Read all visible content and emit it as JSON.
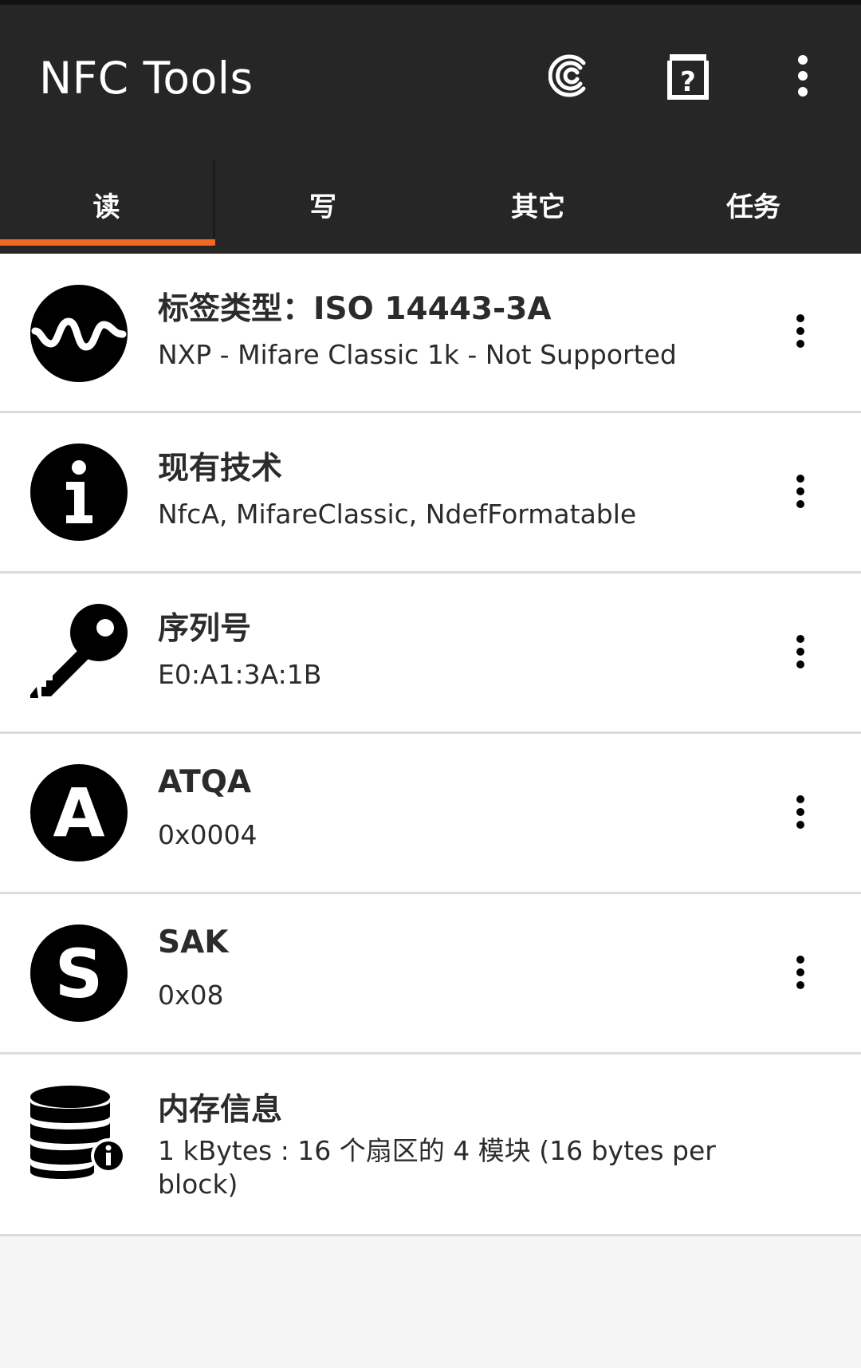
{
  "app": {
    "title": "NFC Tools",
    "accent_color": "#f26722",
    "toolbar_color": "#262626"
  },
  "actions": {
    "credits_icon": "credits-icon",
    "help_icon": "help-icon",
    "overflow_icon": "more-vert-icon"
  },
  "tabs": [
    {
      "label": "读",
      "selected": true
    },
    {
      "label": "写",
      "selected": false
    },
    {
      "label": "其它",
      "selected": false
    },
    {
      "label": "任务",
      "selected": false
    }
  ],
  "items": [
    {
      "icon": "waveform-icon",
      "title": "标签类型：ISO 14443-3A",
      "subtitle": "NXP - Mifare Classic 1k - Not Supported"
    },
    {
      "icon": "info-icon",
      "title": "现有技术",
      "subtitle": "NfcA, MifareClassic, NdefFormatable"
    },
    {
      "icon": "key-icon",
      "title": "序列号",
      "subtitle": "E0:A1:3A:1B"
    },
    {
      "icon": "letter-a-icon",
      "title": "ATQA",
      "subtitle": "0x0004"
    },
    {
      "icon": "letter-s-icon",
      "title": "SAK",
      "subtitle": "0x08"
    },
    {
      "icon": "database-info-icon",
      "title": "内存信息",
      "subtitle": "1 kBytes : 16 个扇区的 4 模块 (16 bytes per block)"
    }
  ]
}
